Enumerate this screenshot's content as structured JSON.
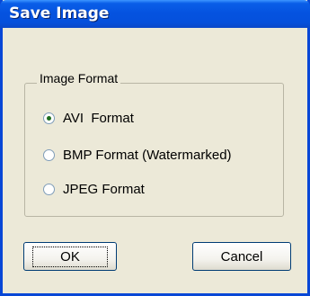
{
  "dialog": {
    "title": "Save Image"
  },
  "group": {
    "legend": "Image Format",
    "options": [
      {
        "label": "AVI  Format",
        "checked": true
      },
      {
        "label": "BMP Format (Watermarked)",
        "checked": false
      },
      {
        "label": "JPEG Format",
        "checked": false
      }
    ]
  },
  "buttons": {
    "ok_label": "OK",
    "cancel_label": "Cancel"
  }
}
